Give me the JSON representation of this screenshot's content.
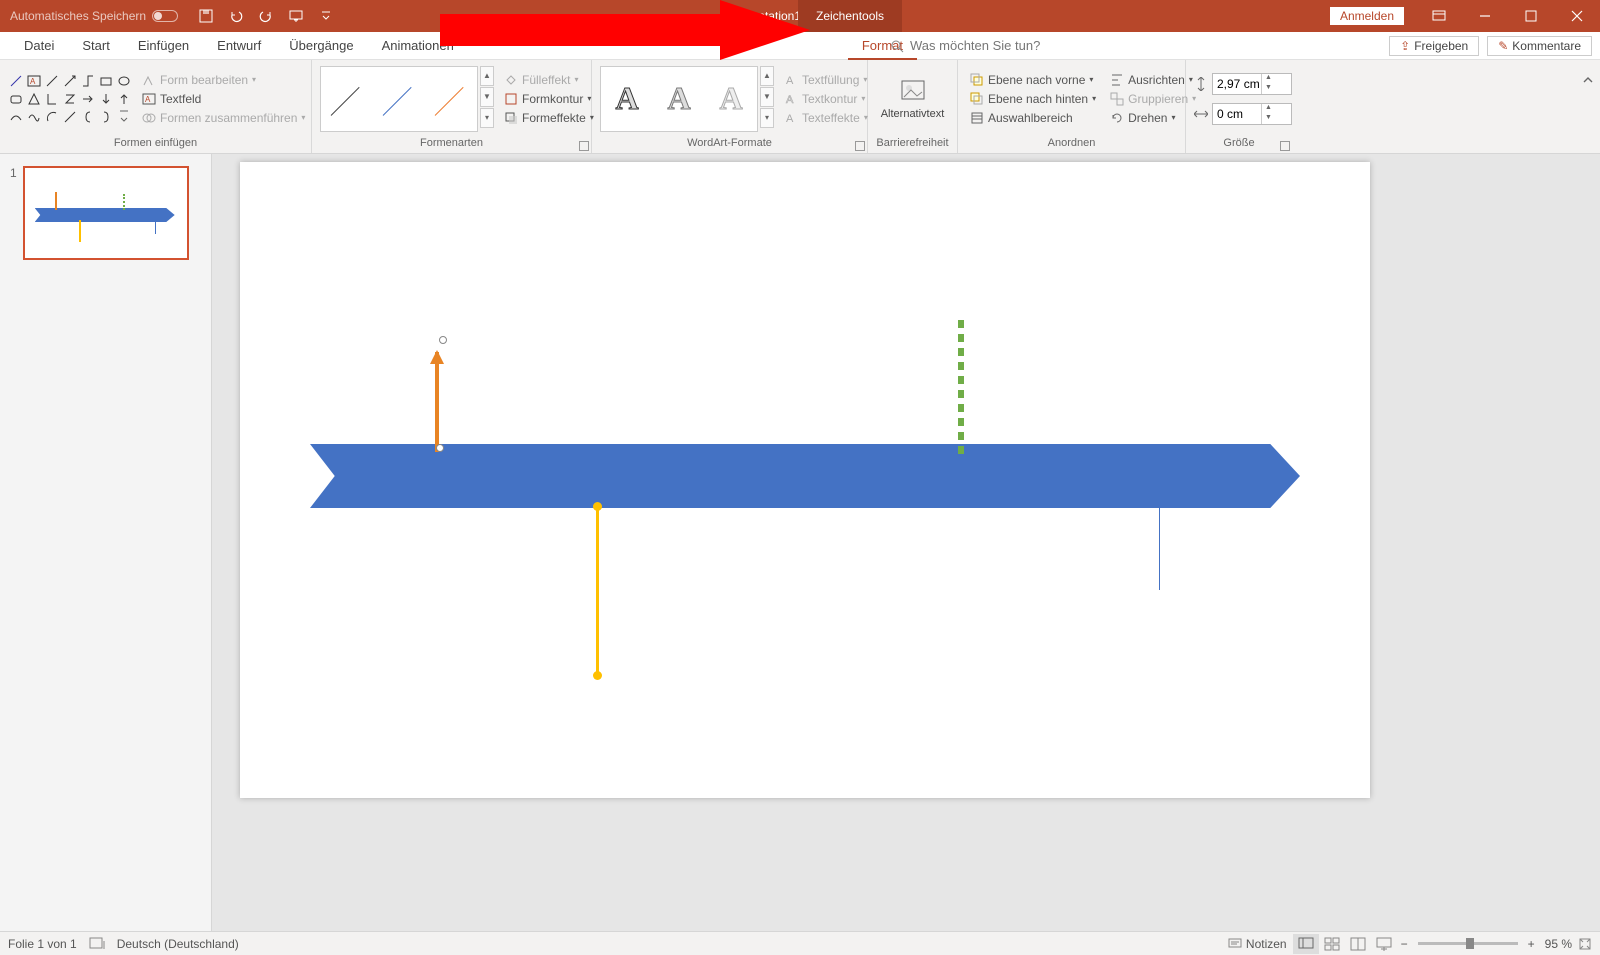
{
  "titlebar": {
    "autosave": "Automatisches Speichern",
    "title": "Präsentation1 - PowerPoint",
    "tool_tab": "Zeichentools",
    "signin": "Anmelden"
  },
  "tabs": {
    "file": "Datei",
    "home": "Start",
    "insert": "Einfügen",
    "design": "Entwurf",
    "transitions": "Übergänge",
    "animations": "Animationen",
    "format": "Format"
  },
  "tellme": {
    "placeholder": "Was möchten Sie tun?"
  },
  "share": {
    "share": "Freigeben",
    "comments": "Kommentare"
  },
  "ribbon": {
    "shapes_group": "Formen einfügen",
    "edit_shape": "Form bearbeiten",
    "textbox": "Textfeld",
    "merge": "Formen zusammenführen",
    "styles_group": "Formenarten",
    "fill": "Fülleffekt",
    "outline": "Formkontur",
    "effects": "Formeffekte",
    "wordart_group": "WordArt-Formate",
    "textfill": "Textfüllung",
    "textoutline": "Textkontur",
    "texteffects": "Texteffekte",
    "acc_group": "Barrierefreiheit",
    "alttext": "Alternativtext",
    "arrange_group": "Anordnen",
    "front": "Ebene nach vorne",
    "back": "Ebene nach hinten",
    "selection": "Auswahlbereich",
    "align": "Ausrichten",
    "group_btn": "Gruppieren",
    "rotate": "Drehen",
    "size_group": "Größe",
    "height": "2,97 cm",
    "width": "0 cm"
  },
  "thumb": {
    "num": "1"
  },
  "status": {
    "slide": "Folie 1 von 1",
    "lang": "Deutsch (Deutschland)",
    "notes": "Notizen",
    "zoom": "95 %"
  }
}
